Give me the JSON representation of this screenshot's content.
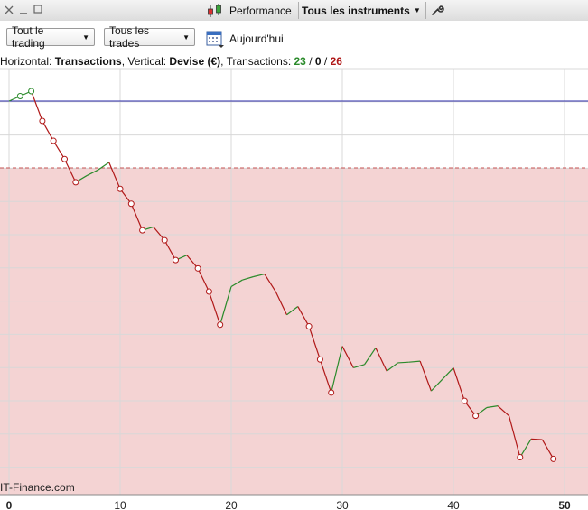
{
  "toolbar": {
    "performance_label": "Performance",
    "instruments_label": "Tous les instruments",
    "icons": [
      "minimize-icon",
      "restore-icon",
      "candlestick-icon",
      "wrench-icon"
    ]
  },
  "filters": {
    "trading_label": "Tout le trading",
    "trades_label": "Tous les trades",
    "period_label": "Aujourd'hui"
  },
  "info": {
    "horizontal_prefix": "Horizontal: ",
    "horizontal_value": "Transactions",
    "vertical_prefix": ", Vertical: ",
    "vertical_value": "Devise (€)",
    "transactions_prefix": ", Transactions: ",
    "winners": "23",
    "slash1": " / ",
    "breakeven": "0",
    "slash2": " / ",
    "losers": "26"
  },
  "watermark": "IT-Finance.com",
  "colors": {
    "gain_line": "#2a8a2a",
    "loss_line": "#b01818",
    "loss_zone": "#f4d3d3",
    "zero_line": "#2a2aa8"
  },
  "chart_data": {
    "type": "line",
    "xlabel": "",
    "ylabel": "",
    "x_ticks": [
      0,
      10,
      20,
      30,
      40,
      50
    ],
    "xlim": [
      0,
      52
    ],
    "grid": true,
    "points": [
      {
        "x": 0,
        "y": 0.0
      },
      {
        "x": 1,
        "y": 0.15
      },
      {
        "x": 2,
        "y": 0.3
      },
      {
        "x": 3,
        "y": -0.6
      },
      {
        "x": 4,
        "y": -1.2
      },
      {
        "x": 5,
        "y": -1.75
      },
      {
        "x": 6,
        "y": -2.45
      },
      {
        "x": 7,
        "y": -2.25
      },
      {
        "x": 8,
        "y": -2.08
      },
      {
        "x": 9,
        "y": -1.85
      },
      {
        "x": 10,
        "y": -2.65
      },
      {
        "x": 11,
        "y": -3.1
      },
      {
        "x": 12,
        "y": -3.9
      },
      {
        "x": 13,
        "y": -3.8
      },
      {
        "x": 14,
        "y": -4.2
      },
      {
        "x": 15,
        "y": -4.8
      },
      {
        "x": 16,
        "y": -4.65
      },
      {
        "x": 17,
        "y": -5.05
      },
      {
        "x": 18,
        "y": -5.75
      },
      {
        "x": 19,
        "y": -6.75
      },
      {
        "x": 20,
        "y": -5.6
      },
      {
        "x": 21,
        "y": -5.4
      },
      {
        "x": 22,
        "y": -5.3
      },
      {
        "x": 23,
        "y": -5.22
      },
      {
        "x": 24,
        "y": -5.75
      },
      {
        "x": 25,
        "y": -6.45
      },
      {
        "x": 26,
        "y": -6.2
      },
      {
        "x": 27,
        "y": -6.8
      },
      {
        "x": 28,
        "y": -7.8
      },
      {
        "x": 29,
        "y": -8.8
      },
      {
        "x": 30,
        "y": -7.4
      },
      {
        "x": 31,
        "y": -8.05
      },
      {
        "x": 32,
        "y": -7.95
      },
      {
        "x": 33,
        "y": -7.45
      },
      {
        "x": 34,
        "y": -8.15
      },
      {
        "x": 35,
        "y": -7.9
      },
      {
        "x": 36,
        "y": -7.88
      },
      {
        "x": 37,
        "y": -7.85
      },
      {
        "x": 38,
        "y": -8.75
      },
      {
        "x": 39,
        "y": -8.4
      },
      {
        "x": 40,
        "y": -8.05
      },
      {
        "x": 41,
        "y": -9.05
      },
      {
        "x": 42,
        "y": -9.5
      },
      {
        "x": 43,
        "y": -9.25
      },
      {
        "x": 44,
        "y": -9.2
      },
      {
        "x": 45,
        "y": -9.5
      },
      {
        "x": 46,
        "y": -10.75
      },
      {
        "x": 47,
        "y": -10.2
      },
      {
        "x": 48,
        "y": -10.22
      },
      {
        "x": 49,
        "y": -10.8
      }
    ]
  }
}
